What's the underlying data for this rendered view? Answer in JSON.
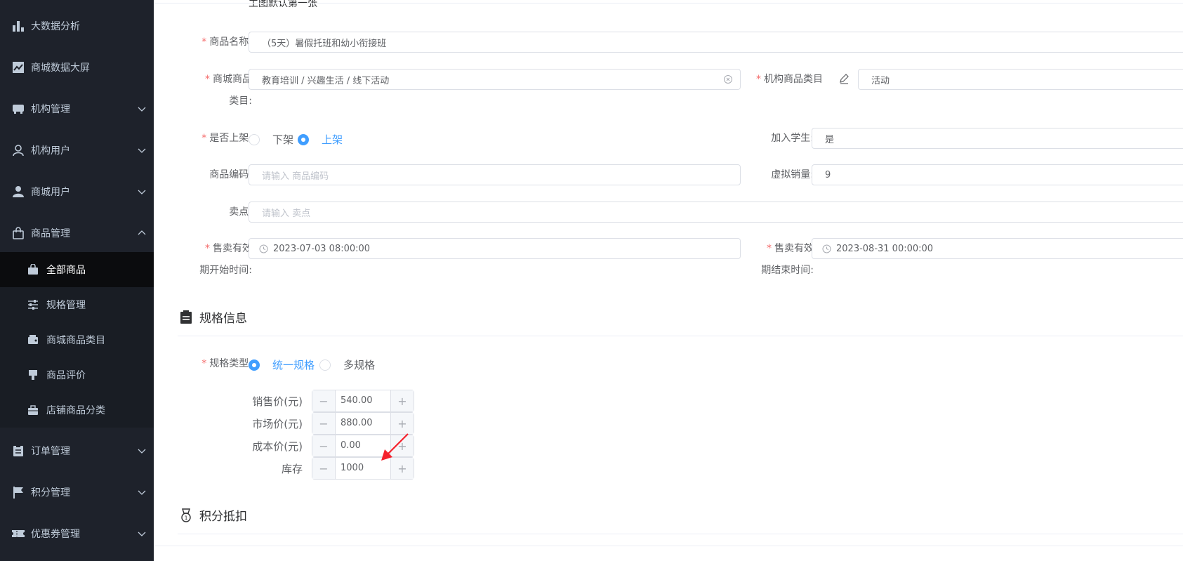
{
  "sidebar": {
    "items": [
      {
        "label": "大数据分析",
        "icon": "bar-chart-icon"
      },
      {
        "label": "商城数据大屏",
        "icon": "line-chart-icon"
      },
      {
        "label": "机构管理",
        "icon": "store-icon"
      },
      {
        "label": "机构用户",
        "icon": "user-outline-icon"
      },
      {
        "label": "商城用户",
        "icon": "user-filled-icon"
      },
      {
        "label": "商品管理",
        "icon": "shopping-bag-icon"
      }
    ],
    "sub_items": [
      {
        "label": "全部商品",
        "icon": "bag-icon"
      },
      {
        "label": "规格管理",
        "icon": "sliders-icon"
      },
      {
        "label": "商城商品类目",
        "icon": "wallet-icon"
      },
      {
        "label": "商品评价",
        "icon": "stamp-icon"
      },
      {
        "label": "店铺商品分类",
        "icon": "briefcase-icon"
      }
    ],
    "bottom_items": [
      {
        "label": "订单管理",
        "icon": "clipboard-icon"
      },
      {
        "label": "积分管理",
        "icon": "flag-icon"
      },
      {
        "label": "优惠券管理",
        "icon": "ticket-icon"
      }
    ]
  },
  "form": {
    "top_note": "主图默认第一张",
    "product_name_label": "商品名称:",
    "product_name_value": "（5天）暑假托班和幼小衔接班",
    "mall_category_label_1": "商城商品",
    "mall_category_label_2": "类目:",
    "mall_category_value": "教育培训 / 兴趣生活 / 线下活动",
    "org_category_label": "机构商品类目",
    "org_category_value": "活动",
    "on_shelf_label": "是否上架:",
    "off_option": "下架",
    "on_option": "上架",
    "join_student_label": "加入学生:",
    "join_student_value": "是",
    "product_code_label": "商品编码:",
    "product_code_placeholder": "请输入 商品编码",
    "virtual_sales_label": "虚拟销量:",
    "virtual_sales_value": "9",
    "selling_point_label": "卖点:",
    "selling_point_placeholder": "请输入 卖点",
    "sale_start_label_1": "售卖有效",
    "sale_start_label_2": "期开始时间:",
    "sale_start_value": "2023-07-03 08:00:00",
    "sale_end_label_1": "售卖有效",
    "sale_end_label_2": "期结束时间:",
    "sale_end_value": "2023-08-31 00:00:00"
  },
  "spec": {
    "title": "规格信息",
    "type_label": "规格类型:",
    "unified_option": "统一规格",
    "multi_option": "多规格",
    "rows": [
      {
        "label": "销售价(元)",
        "value": "540.00"
      },
      {
        "label": "市场价(元)",
        "value": "880.00"
      },
      {
        "label": "成本价(元)",
        "value": "0.00"
      },
      {
        "label": "库存",
        "value": "1000"
      }
    ],
    "minus": "−",
    "plus": "+"
  },
  "points": {
    "title": "积分抵扣"
  },
  "colors": {
    "accent": "#409eff",
    "required": "#f56c6c",
    "annotation_arrow": "#f5222d"
  }
}
